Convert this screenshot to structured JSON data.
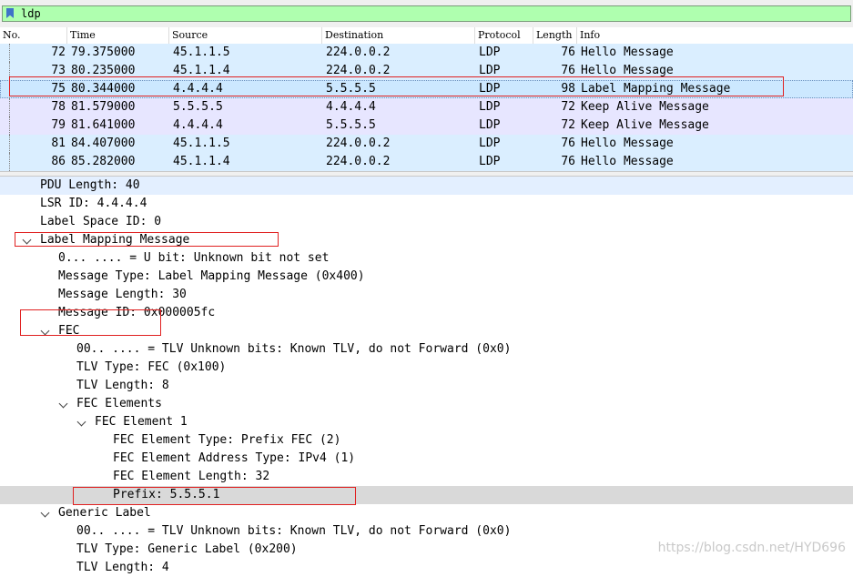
{
  "filter": {
    "value": "ldp"
  },
  "columns": [
    "No.",
    "Time",
    "Source",
    "Destination",
    "Protocol",
    "Length",
    "Info"
  ],
  "packets": [
    {
      "no": "72",
      "time": "79.375000",
      "source": "45.1.1.5",
      "destination": "224.0.0.2",
      "protocol": "LDP",
      "length": "76",
      "info": "Hello Message",
      "kind": "hello"
    },
    {
      "no": "73",
      "time": "80.235000",
      "source": "45.1.1.4",
      "destination": "224.0.0.2",
      "protocol": "LDP",
      "length": "76",
      "info": "Hello Message",
      "kind": "hello"
    },
    {
      "no": "75",
      "time": "80.344000",
      "source": "4.4.4.4",
      "destination": "5.5.5.5",
      "protocol": "LDP",
      "length": "98",
      "info": "Label Mapping Message",
      "kind": "selected"
    },
    {
      "no": "78",
      "time": "81.579000",
      "source": "5.5.5.5",
      "destination": "4.4.4.4",
      "protocol": "LDP",
      "length": "72",
      "info": "Keep Alive Message",
      "kind": "keep"
    },
    {
      "no": "79",
      "time": "81.641000",
      "source": "4.4.4.4",
      "destination": "5.5.5.5",
      "protocol": "LDP",
      "length": "72",
      "info": "Keep Alive Message",
      "kind": "keep"
    },
    {
      "no": "81",
      "time": "84.407000",
      "source": "45.1.1.5",
      "destination": "224.0.0.2",
      "protocol": "LDP",
      "length": "76",
      "info": "Hello Message",
      "kind": "hello"
    },
    {
      "no": "86",
      "time": "85.282000",
      "source": "45.1.1.4",
      "destination": "224.0.0.2",
      "protocol": "LDP",
      "length": "76",
      "info": "Hello Message",
      "kind": "hello"
    }
  ],
  "details": [
    {
      "text": "PDU Length: 40",
      "level": 2,
      "expander": false
    },
    {
      "text": "LSR ID: 4.4.4.4",
      "level": 2,
      "expander": false
    },
    {
      "text": "Label Space ID: 0",
      "level": 2,
      "expander": false
    },
    {
      "text": "Label Mapping Message",
      "level": 2,
      "expander": true
    },
    {
      "text": "0... .... = U bit: Unknown bit not set",
      "level": 3,
      "expander": false
    },
    {
      "text": "Message Type: Label Mapping Message (0x400)",
      "level": 3,
      "expander": false
    },
    {
      "text": "Message Length: 30",
      "level": 3,
      "expander": false
    },
    {
      "text": "Message ID: 0x000005fc",
      "level": 3,
      "expander": false
    },
    {
      "text": "FEC",
      "level": 3,
      "expander": true
    },
    {
      "text": "00.. .... = TLV Unknown bits: Known TLV, do not Forward (0x0)",
      "level": 4,
      "expander": false
    },
    {
      "text": "TLV Type: FEC (0x100)",
      "level": 4,
      "expander": false
    },
    {
      "text": "TLV Length: 8",
      "level": 4,
      "expander": false
    },
    {
      "text": "FEC Elements",
      "level": 4,
      "expander": true
    },
    {
      "text": "FEC Element 1",
      "level": 5,
      "expander": true
    },
    {
      "text": "FEC Element Type: Prefix FEC (2)",
      "level": 6,
      "expander": false
    },
    {
      "text": "FEC Element Address Type: IPv4 (1)",
      "level": 6,
      "expander": false
    },
    {
      "text": "FEC Element Length: 32",
      "level": 6,
      "expander": false
    },
    {
      "text": "Prefix: 5.5.5.1",
      "level": 6,
      "expander": false
    },
    {
      "text": "Generic Label",
      "level": 3,
      "expander": true
    },
    {
      "text": "00.. .... = TLV Unknown bits: Known TLV, do not Forward (0x0)",
      "level": 4,
      "expander": false
    },
    {
      "text": "TLV Type: Generic Label (0x200)",
      "level": 4,
      "expander": false
    },
    {
      "text": "TLV Length: 4",
      "level": 4,
      "expander": false
    }
  ],
  "watermark": "https://blog.csdn.net/HYD696",
  "colors": {
    "filter_ok": "#afffaf",
    "hello_row": "#daeeff",
    "keepalive_row": "#e7e6ff",
    "selected_row": "#cce8ff",
    "highlight_box": "#e02020"
  }
}
